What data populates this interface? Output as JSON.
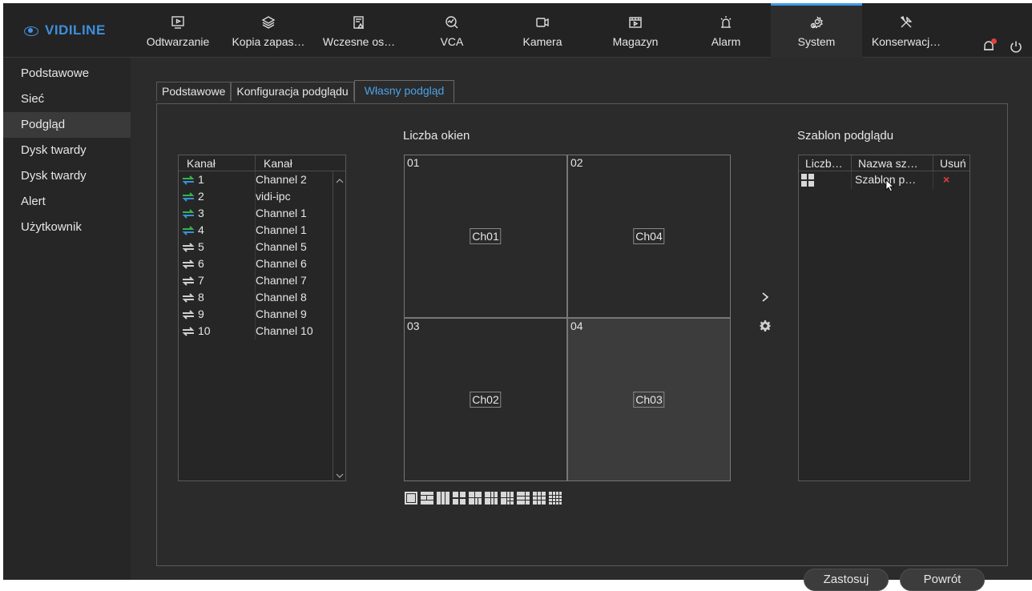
{
  "brand": {
    "logo_text": "VIDILINE"
  },
  "topnav": {
    "items": [
      {
        "label": "Odtwarzanie",
        "icon": "playback-icon"
      },
      {
        "label": "Kopia zapas…",
        "icon": "backup-icon"
      },
      {
        "label": "Wczesne os…",
        "icon": "warning-doc-icon"
      },
      {
        "label": "VCA",
        "icon": "vca-icon"
      },
      {
        "label": "Kamera",
        "icon": "camera-icon"
      },
      {
        "label": "Magazyn",
        "icon": "storage-icon"
      },
      {
        "label": "Alarm",
        "icon": "alarm-icon"
      },
      {
        "label": "System",
        "icon": "system-gear-icon",
        "active": true
      },
      {
        "label": "Konserwacj…",
        "icon": "maintenance-tools-icon"
      }
    ]
  },
  "sidebar": {
    "items": [
      {
        "label": "Podstawowe"
      },
      {
        "label": "Sieć"
      },
      {
        "label": "Podgląd",
        "active": true
      },
      {
        "label": "Dysk twardy"
      },
      {
        "label": "Dysk twardy"
      },
      {
        "label": "Alert"
      },
      {
        "label": "Użytkownik"
      }
    ]
  },
  "tabs": [
    {
      "label": "Podstawowe"
    },
    {
      "label": "Konfiguracja podglądu"
    },
    {
      "label": "Własny podgląd",
      "active": true
    }
  ],
  "channel_table": {
    "headers": [
      "Kanał",
      "Kanał"
    ],
    "rows": [
      {
        "num": "1",
        "name": "Channel 2",
        "status": "online"
      },
      {
        "num": "2",
        "name": "vidi-ipc",
        "status": "online"
      },
      {
        "num": "3",
        "name": "Channel 1",
        "status": "online"
      },
      {
        "num": "4",
        "name": "Channel 1",
        "status": "online"
      },
      {
        "num": "5",
        "name": "Channel 5",
        "status": "offline"
      },
      {
        "num": "6",
        "name": "Channel 6",
        "status": "offline"
      },
      {
        "num": "7",
        "name": "Channel 7",
        "status": "offline"
      },
      {
        "num": "8",
        "name": "Channel 8",
        "status": "offline"
      },
      {
        "num": "9",
        "name": "Channel 9",
        "status": "offline"
      },
      {
        "num": "10",
        "name": "Channel 10",
        "status": "offline"
      }
    ]
  },
  "preview": {
    "label": "Liczba okien",
    "cells": [
      {
        "num": "01",
        "channel": "Ch01"
      },
      {
        "num": "02",
        "channel": "Ch04"
      },
      {
        "num": "03",
        "channel": "Ch02"
      },
      {
        "num": "04",
        "channel": "Ch03",
        "selected": true
      }
    ]
  },
  "template": {
    "label": "Szablon podglądu",
    "headers": [
      "Liczb…",
      "Nazwa sz…",
      "Usuń"
    ],
    "rows": [
      {
        "name": "Szablon p…",
        "delete": "×"
      }
    ]
  },
  "buttons": {
    "apply": "Zastosuj",
    "back": "Powrót"
  },
  "colors": {
    "accent": "#3e9ae6",
    "online_green": "#2eb84b",
    "online_blue": "#3b8ee0",
    "delete_red": "#e0413a"
  }
}
